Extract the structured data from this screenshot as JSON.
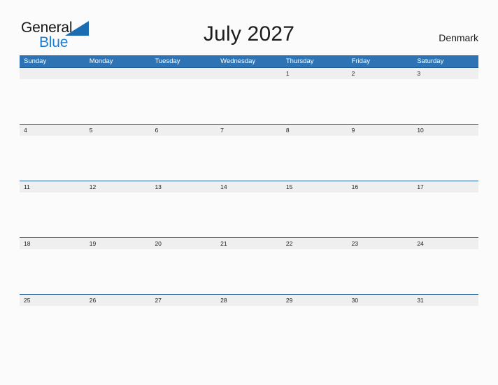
{
  "brand": {
    "name_part1": "General",
    "name_part2": "Blue",
    "triangle_color": "#1b6cb0",
    "part1_color": "#1a1a1a",
    "part2_color": "#1b7fd4"
  },
  "header": {
    "title": "July 2027",
    "country": "Denmark"
  },
  "calendar": {
    "header_color": "#2e74b5",
    "row_divider_color": "#1f5c99",
    "date_band_color": "#efefef",
    "weekdays": [
      "Sunday",
      "Monday",
      "Tuesday",
      "Wednesday",
      "Thursday",
      "Friday",
      "Saturday"
    ],
    "weeks": [
      [
        "",
        "",
        "",
        "",
        "1",
        "2",
        "3"
      ],
      [
        "4",
        "5",
        "6",
        "7",
        "8",
        "9",
        "10"
      ],
      [
        "11",
        "12",
        "13",
        "14",
        "15",
        "16",
        "17"
      ],
      [
        "18",
        "19",
        "20",
        "21",
        "22",
        "23",
        "24"
      ],
      [
        "25",
        "26",
        "27",
        "28",
        "29",
        "30",
        "31"
      ]
    ]
  }
}
